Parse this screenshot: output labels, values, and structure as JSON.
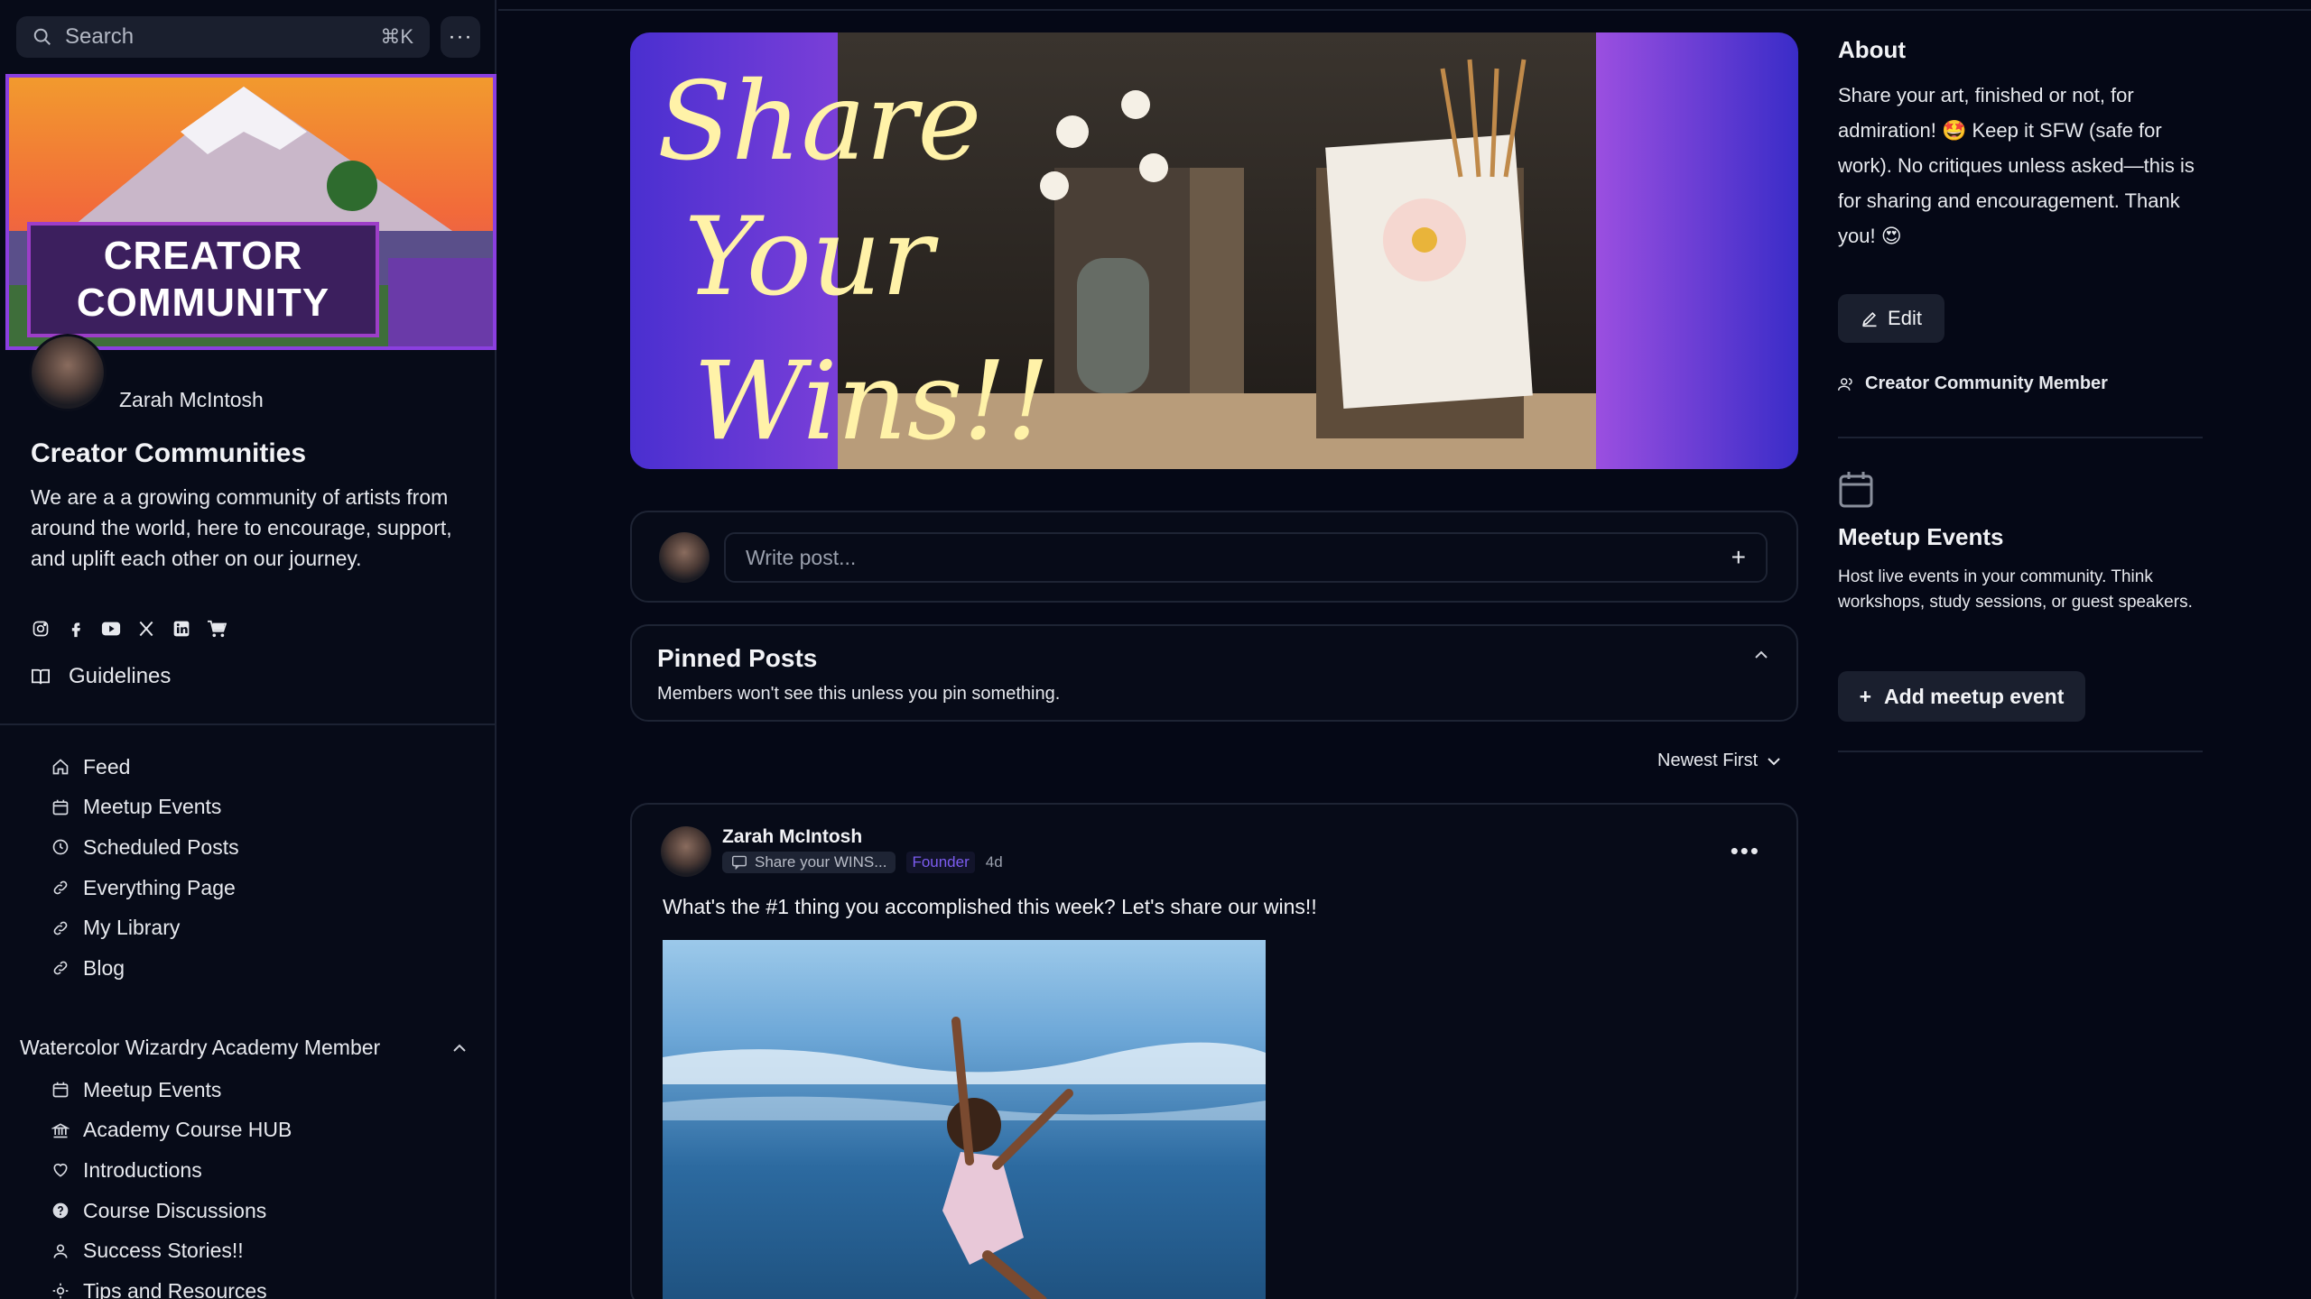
{
  "search": {
    "label": "Search",
    "shortcut": "⌘K",
    "more": "···"
  },
  "cover": {
    "title_line1": "CREATOR",
    "title_line2": "COMMUNITY"
  },
  "profile": {
    "name": "Zarah McIntosh"
  },
  "community": {
    "title": "Creator Communities",
    "description": "We are a a growing community of artists from around the world, here to encourage, support, and uplift each other on our journey."
  },
  "socials": [
    "instagram-icon",
    "facebook-icon",
    "youtube-icon",
    "x-icon",
    "linkedin-icon",
    "cart-icon"
  ],
  "guidelines": {
    "label": "Guidelines"
  },
  "nav_primary": [
    {
      "label": "Feed",
      "icon": "home-icon"
    },
    {
      "label": "Meetup Events",
      "icon": "calendar-icon"
    },
    {
      "label": "Scheduled Posts",
      "icon": "clock-icon"
    },
    {
      "label": "Everything Page",
      "icon": "link-icon"
    },
    {
      "label": "My Library",
      "icon": "link-icon"
    },
    {
      "label": "Blog",
      "icon": "link-icon"
    }
  ],
  "group": {
    "title": "Watercolor Wizardry Academy Member",
    "items": [
      {
        "label": "Meetup Events",
        "icon": "calendar-icon"
      },
      {
        "label": "Academy Course HUB",
        "icon": "bank-icon"
      },
      {
        "label": "Introductions",
        "icon": "heart-icon"
      },
      {
        "label": "Course Discussions",
        "icon": "help-icon"
      },
      {
        "label": "Success Stories!!",
        "icon": "user-icon"
      },
      {
        "label": "Tips and Resources",
        "icon": "sun-icon"
      }
    ]
  },
  "hero": {
    "script_text": [
      "Share",
      "Your",
      "Wins!!"
    ]
  },
  "composer": {
    "placeholder": "Write post...",
    "plus": "+"
  },
  "pinned": {
    "title": "Pinned Posts",
    "subtitle": "Members won't see this unless you pin something."
  },
  "sort": {
    "label": "Newest First"
  },
  "post": {
    "author": "Zarah McIntosh",
    "space": "Share your WINS...",
    "badge": "Founder",
    "time": "4d",
    "body": "What's the #1 thing you accomplished this week? Let's share our wins!!"
  },
  "about": {
    "title": "About",
    "text": "Share your art, finished or not, for admiration! 🤩 Keep it SFW (safe for work). No critiques unless asked—this is for sharing and encouragement. Thank you! 😍",
    "edit_label": "Edit",
    "member_role": "Creator Community Member"
  },
  "meetup": {
    "title": "Meetup Events",
    "description": "Host live events in your community. Think workshops, study sessions, or guest speakers.",
    "button_label": "Add meetup event"
  },
  "colors": {
    "background": "#050816",
    "accent": "#7c5cf0",
    "cover_border": "#8b3fe0"
  }
}
